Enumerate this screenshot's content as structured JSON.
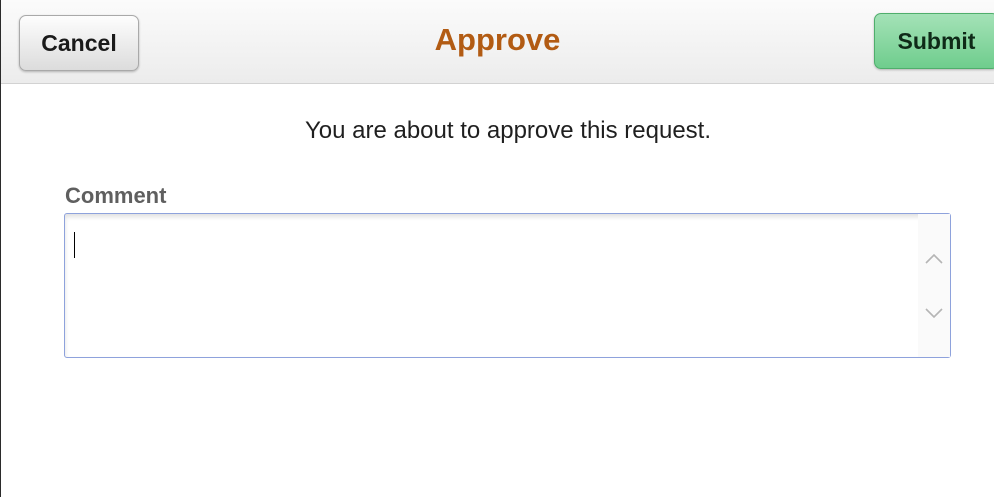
{
  "header": {
    "cancel_label": "Cancel",
    "title": "Approve",
    "submit_label": "Submit"
  },
  "main": {
    "message": "You are about to approve this request.",
    "comment_label": "Comment",
    "comment_value": ""
  },
  "icons": {
    "scroll_up": "chevron-up-icon",
    "scroll_down": "chevron-down-icon"
  },
  "colors": {
    "title": "#b25b13",
    "submit_bg": "#7fd49a",
    "input_border": "#8ea2dc"
  }
}
